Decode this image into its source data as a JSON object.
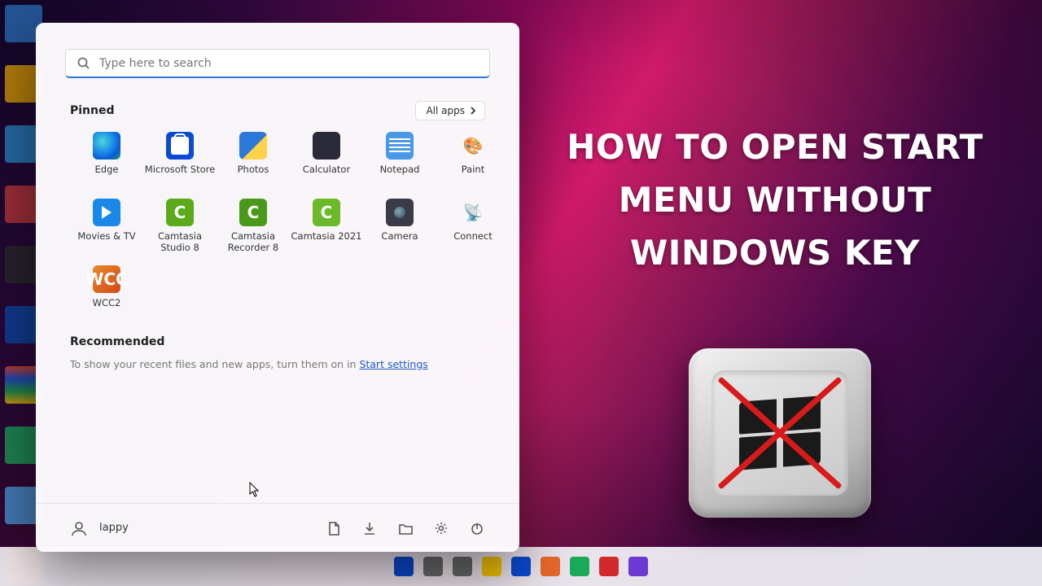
{
  "start": {
    "search_placeholder": "Type here to search",
    "pinned_label": "Pinned",
    "all_apps_label": "All apps",
    "apps": [
      {
        "id": "edge",
        "label": "Edge"
      },
      {
        "id": "store",
        "label": "Microsoft Store"
      },
      {
        "id": "photos",
        "label": "Photos"
      },
      {
        "id": "calc",
        "label": "Calculator"
      },
      {
        "id": "notepad",
        "label": "Notepad"
      },
      {
        "id": "paint",
        "label": "Paint"
      },
      {
        "id": "movies",
        "label": "Movies & TV"
      },
      {
        "id": "camstudio",
        "label": "Camtasia Studio 8"
      },
      {
        "id": "camrec",
        "label": "Camtasia Recorder 8"
      },
      {
        "id": "cam2021",
        "label": "Camtasia 2021"
      },
      {
        "id": "camera",
        "label": "Camera"
      },
      {
        "id": "connect",
        "label": "Connect"
      },
      {
        "id": "wcc2",
        "label": "WCC2"
      }
    ],
    "recommended_label": "Recommended",
    "recommended_text": "To show your recent files and new apps, turn them on in ",
    "recommended_link": "Start settings",
    "user_name": "lappy"
  },
  "overlay": {
    "title": "HOW TO OPEN START MENU WITHOUT WINDOWS KEY"
  }
}
